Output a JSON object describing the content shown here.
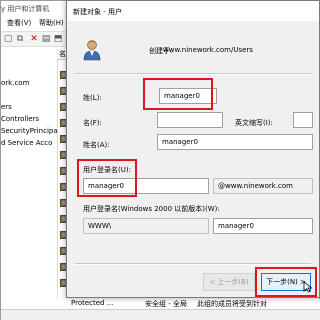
{
  "background_window": {
    "title": "y 用户和计算机",
    "menu": {
      "view": "查看(V)",
      "help": "帮助(H)"
    },
    "tree_items": [
      "ork.com",
      "ers",
      "Controllers",
      "SecurityPrincipa",
      "d Service Acco"
    ],
    "list_header": "名",
    "status_row": {
      "col1": "Protected ...",
      "col2": "安全组 - 全局",
      "col3": "此组的成员将受到针对"
    }
  },
  "dialog": {
    "title": "新建对象 - 用户",
    "created_in_label": "创建于:",
    "created_in_value": "www.ninework.com/Users",
    "last_name": {
      "label": "姓(L):",
      "value": "manager0"
    },
    "first_name": {
      "label": "名(F):",
      "value": ""
    },
    "initials": {
      "label": "英文缩写(I):",
      "value": ""
    },
    "full_name": {
      "label": "姓名(A):",
      "value": "manager0"
    },
    "logon_name": {
      "label": "用户登录名(U):",
      "value": "manager0",
      "domain": "@www.ninework.com"
    },
    "pre2000": {
      "label": "用户登录名(Windows 2000 以前版本)(W):",
      "domain": "WWW\\",
      "value": "manager0"
    },
    "buttons": {
      "back": "< 上一步(B)",
      "next": "下一步(N) >"
    }
  },
  "colors": {
    "highlight": "#e0161e",
    "primary_border": "#0078d7"
  },
  "icons": {
    "user": "user-icon",
    "cursor": "mouse-cursor-icon"
  }
}
